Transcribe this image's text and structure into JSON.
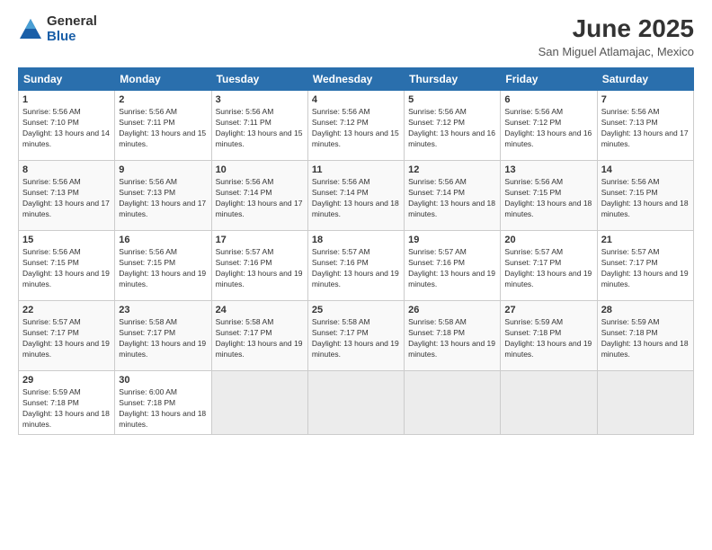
{
  "logo": {
    "general": "General",
    "blue": "Blue"
  },
  "title": "June 2025",
  "location": "San Miguel Atlamajac, Mexico",
  "headers": [
    "Sunday",
    "Monday",
    "Tuesday",
    "Wednesday",
    "Thursday",
    "Friday",
    "Saturday"
  ],
  "weeks": [
    [
      {
        "day": "1",
        "sunrise": "5:56 AM",
        "sunset": "7:10 PM",
        "daylight": "13 hours and 14 minutes."
      },
      {
        "day": "2",
        "sunrise": "5:56 AM",
        "sunset": "7:11 PM",
        "daylight": "13 hours and 15 minutes."
      },
      {
        "day": "3",
        "sunrise": "5:56 AM",
        "sunset": "7:11 PM",
        "daylight": "13 hours and 15 minutes."
      },
      {
        "day": "4",
        "sunrise": "5:56 AM",
        "sunset": "7:12 PM",
        "daylight": "13 hours and 15 minutes."
      },
      {
        "day": "5",
        "sunrise": "5:56 AM",
        "sunset": "7:12 PM",
        "daylight": "13 hours and 16 minutes."
      },
      {
        "day": "6",
        "sunrise": "5:56 AM",
        "sunset": "7:12 PM",
        "daylight": "13 hours and 16 minutes."
      },
      {
        "day": "7",
        "sunrise": "5:56 AM",
        "sunset": "7:13 PM",
        "daylight": "13 hours and 17 minutes."
      }
    ],
    [
      {
        "day": "8",
        "sunrise": "5:56 AM",
        "sunset": "7:13 PM",
        "daylight": "13 hours and 17 minutes."
      },
      {
        "day": "9",
        "sunrise": "5:56 AM",
        "sunset": "7:13 PM",
        "daylight": "13 hours and 17 minutes."
      },
      {
        "day": "10",
        "sunrise": "5:56 AM",
        "sunset": "7:14 PM",
        "daylight": "13 hours and 17 minutes."
      },
      {
        "day": "11",
        "sunrise": "5:56 AM",
        "sunset": "7:14 PM",
        "daylight": "13 hours and 18 minutes."
      },
      {
        "day": "12",
        "sunrise": "5:56 AM",
        "sunset": "7:14 PM",
        "daylight": "13 hours and 18 minutes."
      },
      {
        "day": "13",
        "sunrise": "5:56 AM",
        "sunset": "7:15 PM",
        "daylight": "13 hours and 18 minutes."
      },
      {
        "day": "14",
        "sunrise": "5:56 AM",
        "sunset": "7:15 PM",
        "daylight": "13 hours and 18 minutes."
      }
    ],
    [
      {
        "day": "15",
        "sunrise": "5:56 AM",
        "sunset": "7:15 PM",
        "daylight": "13 hours and 19 minutes."
      },
      {
        "day": "16",
        "sunrise": "5:56 AM",
        "sunset": "7:15 PM",
        "daylight": "13 hours and 19 minutes."
      },
      {
        "day": "17",
        "sunrise": "5:57 AM",
        "sunset": "7:16 PM",
        "daylight": "13 hours and 19 minutes."
      },
      {
        "day": "18",
        "sunrise": "5:57 AM",
        "sunset": "7:16 PM",
        "daylight": "13 hours and 19 minutes."
      },
      {
        "day": "19",
        "sunrise": "5:57 AM",
        "sunset": "7:16 PM",
        "daylight": "13 hours and 19 minutes."
      },
      {
        "day": "20",
        "sunrise": "5:57 AM",
        "sunset": "7:17 PM",
        "daylight": "13 hours and 19 minutes."
      },
      {
        "day": "21",
        "sunrise": "5:57 AM",
        "sunset": "7:17 PM",
        "daylight": "13 hours and 19 minutes."
      }
    ],
    [
      {
        "day": "22",
        "sunrise": "5:57 AM",
        "sunset": "7:17 PM",
        "daylight": "13 hours and 19 minutes."
      },
      {
        "day": "23",
        "sunrise": "5:58 AM",
        "sunset": "7:17 PM",
        "daylight": "13 hours and 19 minutes."
      },
      {
        "day": "24",
        "sunrise": "5:58 AM",
        "sunset": "7:17 PM",
        "daylight": "13 hours and 19 minutes."
      },
      {
        "day": "25",
        "sunrise": "5:58 AM",
        "sunset": "7:17 PM",
        "daylight": "13 hours and 19 minutes."
      },
      {
        "day": "26",
        "sunrise": "5:58 AM",
        "sunset": "7:18 PM",
        "daylight": "13 hours and 19 minutes."
      },
      {
        "day": "27",
        "sunrise": "5:59 AM",
        "sunset": "7:18 PM",
        "daylight": "13 hours and 19 minutes."
      },
      {
        "day": "28",
        "sunrise": "5:59 AM",
        "sunset": "7:18 PM",
        "daylight": "13 hours and 18 minutes."
      }
    ],
    [
      {
        "day": "29",
        "sunrise": "5:59 AM",
        "sunset": "7:18 PM",
        "daylight": "13 hours and 18 minutes."
      },
      {
        "day": "30",
        "sunrise": "6:00 AM",
        "sunset": "7:18 PM",
        "daylight": "13 hours and 18 minutes."
      },
      null,
      null,
      null,
      null,
      null
    ]
  ]
}
